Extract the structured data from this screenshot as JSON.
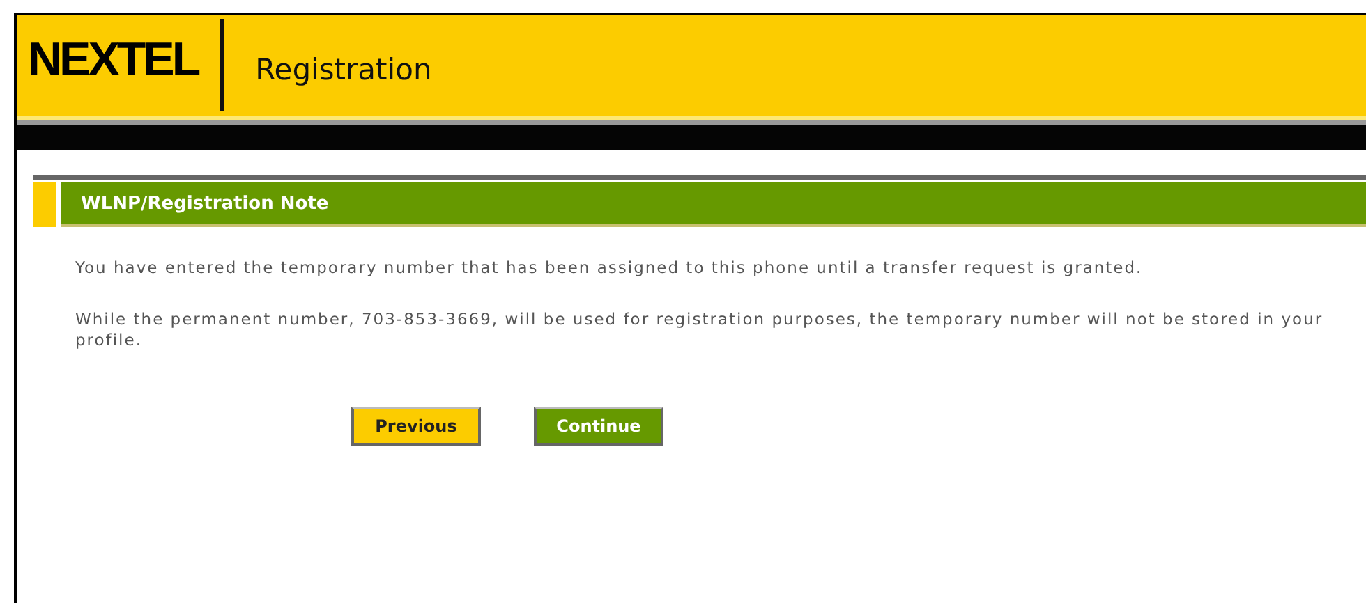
{
  "header": {
    "logo": "NEXTEL",
    "title": "Registration"
  },
  "note": {
    "title": "WLNP/Registration Note",
    "paragraphs": [
      "You have entered the temporary number that has been assigned to this phone until a transfer request is granted.",
      "While the permanent number, 703-853-3669, will be used for registration purposes, the temporary number will not be stored in your profile."
    ]
  },
  "buttons": [
    {
      "label": "Previous",
      "kind": "secondary"
    },
    {
      "label": "Continue",
      "kind": "primary"
    }
  ]
}
